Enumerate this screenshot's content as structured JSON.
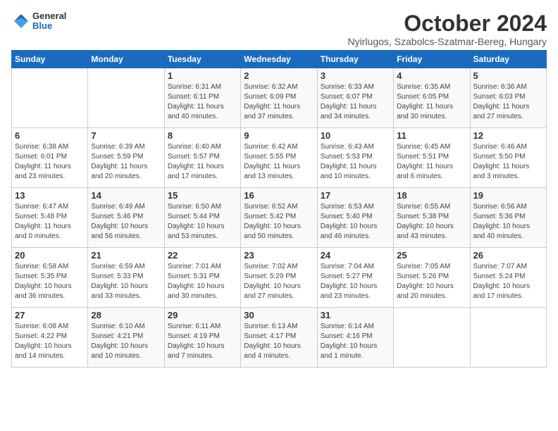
{
  "logo": {
    "general": "General",
    "blue": "Blue"
  },
  "title": "October 2024",
  "subtitle": "Nyirlugos, Szabolcs-Szatmar-Bereg, Hungary",
  "headers": [
    "Sunday",
    "Monday",
    "Tuesday",
    "Wednesday",
    "Thursday",
    "Friday",
    "Saturday"
  ],
  "weeks": [
    [
      {
        "day": "",
        "info": ""
      },
      {
        "day": "",
        "info": ""
      },
      {
        "day": "1",
        "info": "Sunrise: 6:31 AM\nSunset: 6:11 PM\nDaylight: 11 hours\nand 40 minutes."
      },
      {
        "day": "2",
        "info": "Sunrise: 6:32 AM\nSunset: 6:09 PM\nDaylight: 11 hours\nand 37 minutes."
      },
      {
        "day": "3",
        "info": "Sunrise: 6:33 AM\nSunset: 6:07 PM\nDaylight: 11 hours\nand 34 minutes."
      },
      {
        "day": "4",
        "info": "Sunrise: 6:35 AM\nSunset: 6:05 PM\nDaylight: 11 hours\nand 30 minutes."
      },
      {
        "day": "5",
        "info": "Sunrise: 6:36 AM\nSunset: 6:03 PM\nDaylight: 11 hours\nand 27 minutes."
      }
    ],
    [
      {
        "day": "6",
        "info": "Sunrise: 6:38 AM\nSunset: 6:01 PM\nDaylight: 11 hours\nand 23 minutes."
      },
      {
        "day": "7",
        "info": "Sunrise: 6:39 AM\nSunset: 5:59 PM\nDaylight: 11 hours\nand 20 minutes."
      },
      {
        "day": "8",
        "info": "Sunrise: 6:40 AM\nSunset: 5:57 PM\nDaylight: 11 hours\nand 17 minutes."
      },
      {
        "day": "9",
        "info": "Sunrise: 6:42 AM\nSunset: 5:55 PM\nDaylight: 11 hours\nand 13 minutes."
      },
      {
        "day": "10",
        "info": "Sunrise: 6:43 AM\nSunset: 5:53 PM\nDaylight: 11 hours\nand 10 minutes."
      },
      {
        "day": "11",
        "info": "Sunrise: 6:45 AM\nSunset: 5:51 PM\nDaylight: 11 hours\nand 6 minutes."
      },
      {
        "day": "12",
        "info": "Sunrise: 6:46 AM\nSunset: 5:50 PM\nDaylight: 11 hours\nand 3 minutes."
      }
    ],
    [
      {
        "day": "13",
        "info": "Sunrise: 6:47 AM\nSunset: 5:48 PM\nDaylight: 11 hours\nand 0 minutes."
      },
      {
        "day": "14",
        "info": "Sunrise: 6:49 AM\nSunset: 5:46 PM\nDaylight: 10 hours\nand 56 minutes."
      },
      {
        "day": "15",
        "info": "Sunrise: 6:50 AM\nSunset: 5:44 PM\nDaylight: 10 hours\nand 53 minutes."
      },
      {
        "day": "16",
        "info": "Sunrise: 6:52 AM\nSunset: 5:42 PM\nDaylight: 10 hours\nand 50 minutes."
      },
      {
        "day": "17",
        "info": "Sunrise: 6:53 AM\nSunset: 5:40 PM\nDaylight: 10 hours\nand 46 minutes."
      },
      {
        "day": "18",
        "info": "Sunrise: 6:55 AM\nSunset: 5:38 PM\nDaylight: 10 hours\nand 43 minutes."
      },
      {
        "day": "19",
        "info": "Sunrise: 6:56 AM\nSunset: 5:36 PM\nDaylight: 10 hours\nand 40 minutes."
      }
    ],
    [
      {
        "day": "20",
        "info": "Sunrise: 6:58 AM\nSunset: 5:35 PM\nDaylight: 10 hours\nand 36 minutes."
      },
      {
        "day": "21",
        "info": "Sunrise: 6:59 AM\nSunset: 5:33 PM\nDaylight: 10 hours\nand 33 minutes."
      },
      {
        "day": "22",
        "info": "Sunrise: 7:01 AM\nSunset: 5:31 PM\nDaylight: 10 hours\nand 30 minutes."
      },
      {
        "day": "23",
        "info": "Sunrise: 7:02 AM\nSunset: 5:29 PM\nDaylight: 10 hours\nand 27 minutes."
      },
      {
        "day": "24",
        "info": "Sunrise: 7:04 AM\nSunset: 5:27 PM\nDaylight: 10 hours\nand 23 minutes."
      },
      {
        "day": "25",
        "info": "Sunrise: 7:05 AM\nSunset: 5:26 PM\nDaylight: 10 hours\nand 20 minutes."
      },
      {
        "day": "26",
        "info": "Sunrise: 7:07 AM\nSunset: 5:24 PM\nDaylight: 10 hours\nand 17 minutes."
      }
    ],
    [
      {
        "day": "27",
        "info": "Sunrise: 6:08 AM\nSunset: 4:22 PM\nDaylight: 10 hours\nand 14 minutes."
      },
      {
        "day": "28",
        "info": "Sunrise: 6:10 AM\nSunset: 4:21 PM\nDaylight: 10 hours\nand 10 minutes."
      },
      {
        "day": "29",
        "info": "Sunrise: 6:11 AM\nSunset: 4:19 PM\nDaylight: 10 hours\nand 7 minutes."
      },
      {
        "day": "30",
        "info": "Sunrise: 6:13 AM\nSunset: 4:17 PM\nDaylight: 10 hours\nand 4 minutes."
      },
      {
        "day": "31",
        "info": "Sunrise: 6:14 AM\nSunset: 4:16 PM\nDaylight: 10 hours\nand 1 minute."
      },
      {
        "day": "",
        "info": ""
      },
      {
        "day": "",
        "info": ""
      }
    ]
  ]
}
